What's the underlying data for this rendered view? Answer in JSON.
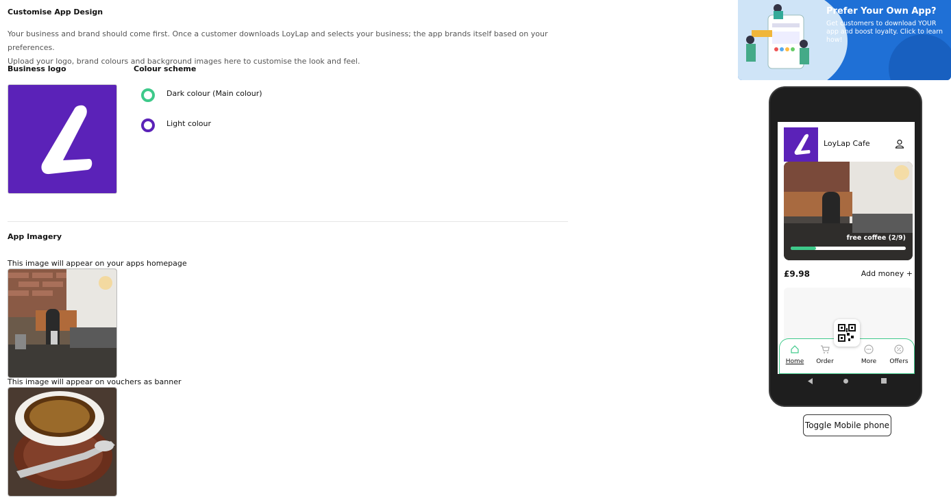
{
  "design": {
    "title": "Customise App Design",
    "description_line1": "Your business and brand should come first. Once a customer downloads LoyLap and selects your business; the app brands itself based on your preferences.",
    "description_line2": "Upload your logo, brand colours and background images here to customise the look and feel.",
    "logo_heading": "Business logo",
    "colour_heading": "Colour scheme",
    "colours": [
      {
        "label": "Dark colour (Main colour)",
        "color": "#3ec98a"
      },
      {
        "label": "Light colour",
        "color": "#5b22b8"
      }
    ],
    "brand_color": "#5b22b8"
  },
  "imagery": {
    "heading": "App Imagery",
    "homepage_caption": "This image will appear on your apps homepage",
    "voucher_caption": "This image will appear on vouchers as banner"
  },
  "promo": {
    "title": "Prefer Your Own App?",
    "text": "Get customers to download YOUR app and boost loyalty. Click to learn how!"
  },
  "phone": {
    "cafe_name": "LoyLap Cafe",
    "reward_label": "free coffee (2/9)",
    "reward_progress": 0.22,
    "balance": "£9.98",
    "add_money": "Add money +",
    "nav": [
      "Home",
      "Order",
      "More",
      "Offers"
    ],
    "accent": "#3ec98a"
  },
  "toggle_button": "Toggle Mobile phone"
}
